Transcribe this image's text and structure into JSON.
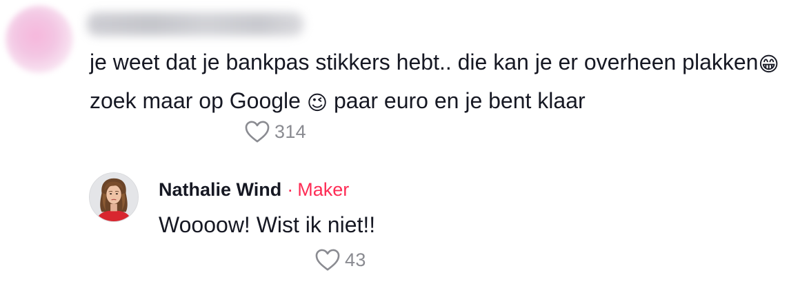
{
  "comment": {
    "text_part1": "je weet dat je bankpas stikkers hebt.. die kan je er overheen plakken",
    "emoji_grin": "😁",
    "text_part2": " zoek maar op Google ",
    "emoji_wink": "😉",
    "text_part3": " paar euro en je bent klaar",
    "like_count": "314",
    "like_icon": "heart-outline-icon"
  },
  "reply": {
    "author_name": "Nathalie Wind",
    "separator": "·",
    "author_badge": "Maker",
    "text": "Woooow! Wist ik niet!!",
    "like_count": "43",
    "like_icon": "heart-outline-icon"
  },
  "colors": {
    "text_primary": "#161823",
    "text_secondary": "#8a8b91",
    "accent": "#fe2c55"
  }
}
